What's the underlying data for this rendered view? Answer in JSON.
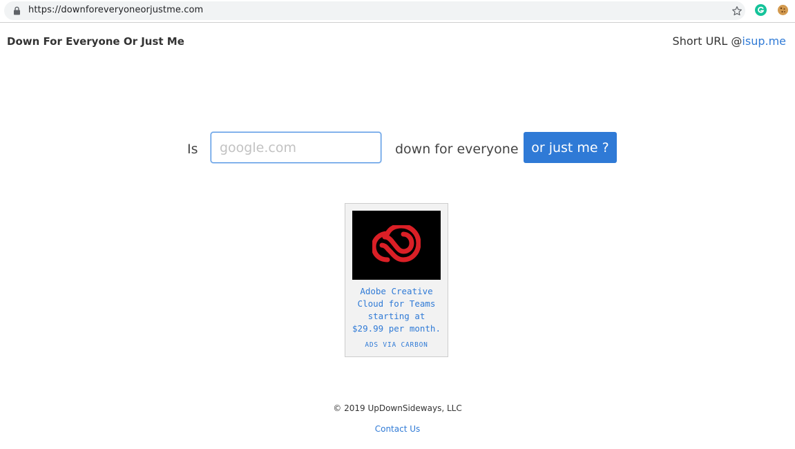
{
  "browser": {
    "url": "https://downforeveryoneorjustme.com",
    "icons": [
      "lock-icon",
      "star-icon",
      "grammarly-extension-icon",
      "cookie-extension-icon"
    ]
  },
  "header": {
    "title": "Down For Everyone Or Just Me",
    "short_url_prefix": "Short URL @",
    "short_url_link": "isup.me"
  },
  "form": {
    "is_label": "Is",
    "input_placeholder": "google.com",
    "input_value": "",
    "down_label": "down for everyone",
    "submit_label": "or just me ?"
  },
  "ad": {
    "text": "Adobe Creative Cloud for Teams starting at $29.99 per month.",
    "via": "ADS VIA CARBON",
    "image_icon": "adobe-creative-cloud-logo"
  },
  "footer": {
    "copyright": "© 2019 UpDownSideways, LLC",
    "contact": "Contact Us"
  },
  "colors": {
    "accent": "#2f7ad6",
    "ad_logo_red": "#da1f26"
  }
}
